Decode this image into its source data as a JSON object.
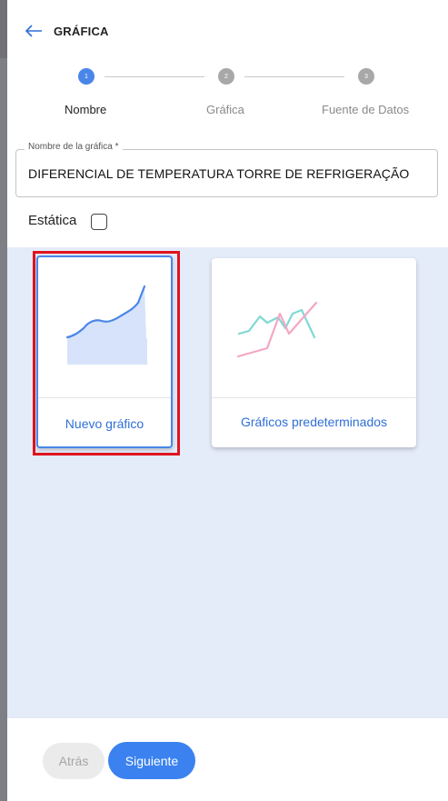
{
  "header": {
    "title": "GRÁFICA",
    "back_icon": "arrow-left-icon"
  },
  "stepper": {
    "steps": [
      {
        "number": "1",
        "label": "Nombre",
        "state": "active"
      },
      {
        "number": "2",
        "label": "Gráfica",
        "state": "inactive"
      },
      {
        "number": "3",
        "label": "Fuente de Datos",
        "state": "inactive"
      }
    ]
  },
  "form": {
    "chart_name_label": "Nombre de la gráfica *",
    "chart_name_value": "DIFERENCIAL DE TEMPERATURA TORRE DE REFRIGERAÇÃO",
    "static_label": "Estática",
    "static_checked": false
  },
  "options": [
    {
      "label": "Nuevo gráfico",
      "icon": "area-chart-icon",
      "selected": true
    },
    {
      "label": "Gráficos predeterminados",
      "icon": "line-chart-icon",
      "selected": false
    }
  ],
  "footer": {
    "back_label": "Atrás",
    "next_label": "Siguiente"
  },
  "colors": {
    "accent": "#4a86e8",
    "highlight": "#e0141e",
    "panel_bg": "#e4ebf9",
    "line_pink": "#f4a6c4",
    "line_teal": "#7fd9d3"
  }
}
